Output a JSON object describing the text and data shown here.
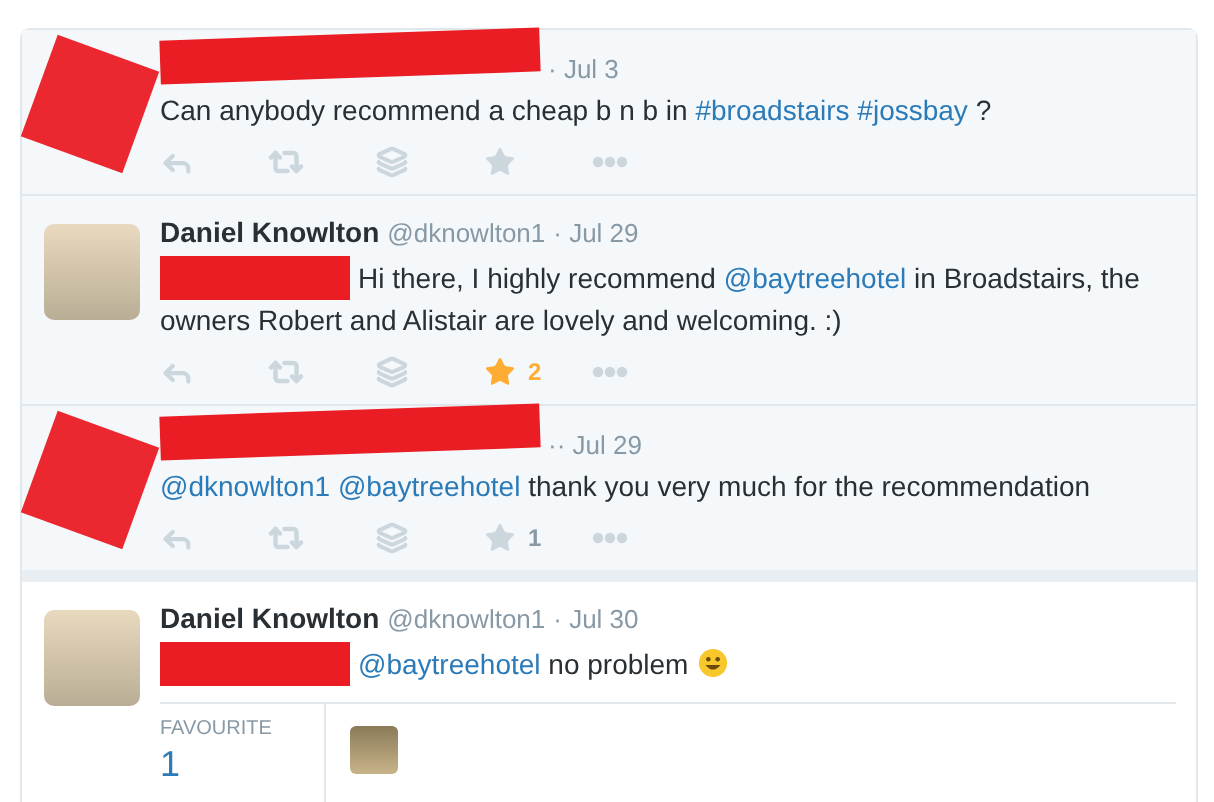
{
  "tweets": [
    {
      "kind": "collapsed",
      "avatar_redacted": true,
      "header": {
        "redacted": true,
        "date": "· Jul 3"
      },
      "mention_redacted": false,
      "segments": [
        {
          "kind": "text",
          "text": "Can anybody recommend a cheap b n b in "
        },
        {
          "kind": "link",
          "text": "#broadstairs"
        },
        {
          "kind": "link",
          "text": "#jossbay"
        },
        {
          "kind": "text",
          "text": " ?"
        }
      ],
      "favourited": false
    },
    {
      "kind": "collapsed",
      "avatar_redacted": false,
      "header": {
        "redacted": false,
        "name": "Daniel Knowlton",
        "handle": "@dknowlton1",
        "date": "· Jul 29"
      },
      "mention_redacted": true,
      "segments": [
        {
          "kind": "text",
          "text": "Hi there, I highly recommend "
        },
        {
          "kind": "link",
          "text": "@baytreehotel"
        },
        {
          "kind": "text",
          "text": " in Broadstairs, the owners Robert and Alistair are lovely and welcoming. :)"
        }
      ],
      "favourited": true,
      "favourite_count": "2"
    },
    {
      "kind": "collapsed",
      "avatar_redacted": true,
      "header": {
        "redacted": true,
        "date": "·· Jul 29"
      },
      "mention_redacted": false,
      "segments": [
        {
          "kind": "link",
          "text": "@dknowlton1"
        },
        {
          "kind": "link",
          "text": "@baytreehotel"
        },
        {
          "kind": "text",
          "text": " thank you very much for the recommendation"
        }
      ],
      "favourited": false,
      "favourite_count": "1"
    },
    {
      "kind": "expanded",
      "avatar_redacted": false,
      "header": {
        "redacted": false,
        "name": "Daniel Knowlton",
        "handle": "@dknowlton1",
        "date": "· Jul 30"
      },
      "mention_redacted": true,
      "segments": [
        {
          "kind": "link",
          "text": "@baytreehotel"
        },
        {
          "kind": "text",
          "text": " no problem"
        },
        {
          "kind": "smiley"
        }
      ],
      "stats": {
        "label": "FAVOURITE",
        "value": "1"
      }
    }
  ]
}
